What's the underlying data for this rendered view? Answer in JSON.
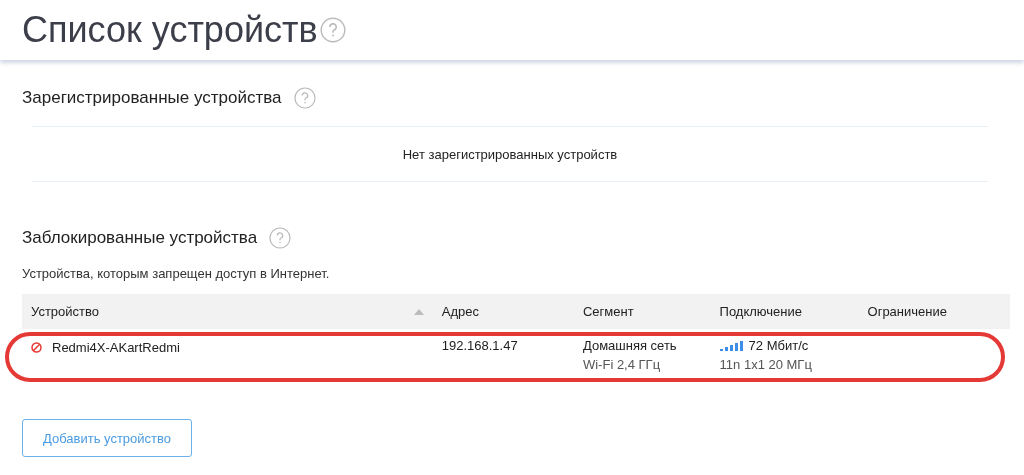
{
  "header": {
    "title": "Список устройств"
  },
  "registered": {
    "title": "Зарегистрированные устройства",
    "empty_text": "Нет зарегистрированных устройств"
  },
  "blocked": {
    "title": "Заблокированные устройства",
    "description": "Устройства, которым запрещен доступ в Интернет.",
    "table": {
      "columns": [
        {
          "label": "Устройство",
          "sorted": true
        },
        {
          "label": "Адрес",
          "sorted": false
        },
        {
          "label": "Сегмент",
          "sorted": false
        },
        {
          "label": "Подключение",
          "sorted": false
        },
        {
          "label": "Ограничение",
          "sorted": false
        }
      ],
      "rows": [
        {
          "blocked": true,
          "name": "Redmi4X-AKartRedmi",
          "address": "192.168.1.47",
          "segment": "Домашняя сеть",
          "segment_detail": "Wi-Fi 2,4 ГГц",
          "speed": "72 Мбит/с",
          "connection_detail": "11n 1x1 20 МГц",
          "highlighted": true
        }
      ]
    }
  },
  "add_button": "Добавить устройство"
}
